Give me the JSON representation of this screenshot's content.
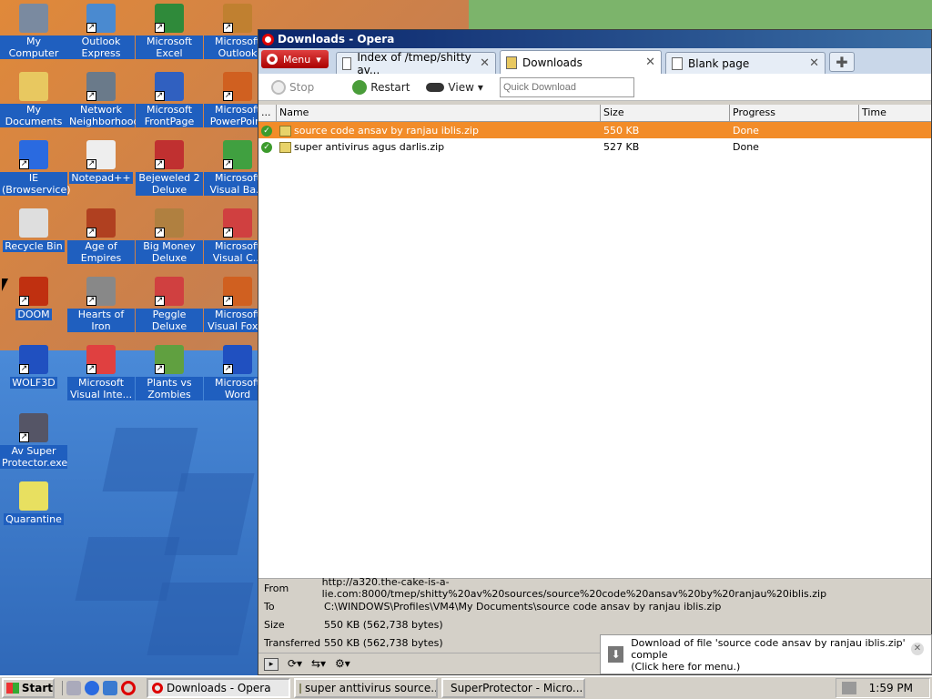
{
  "desktop": {
    "icons": [
      {
        "label": "My Computer",
        "icon": "computer-icon"
      },
      {
        "label": "Outlook Express",
        "icon": "outlook-express-icon"
      },
      {
        "label": "Microsoft Excel",
        "icon": "excel-icon"
      },
      {
        "label": "Microsoft Outlook",
        "icon": "outlook-icon"
      },
      {
        "label": "My Documents",
        "icon": "folder-documents-icon"
      },
      {
        "label": "Network Neighborhood",
        "icon": "network-icon"
      },
      {
        "label": "Microsoft FrontPage",
        "icon": "frontpage-icon"
      },
      {
        "label": "Microsoft PowerPoint",
        "icon": "powerpoint-icon"
      },
      {
        "label": "IE (Browservice)",
        "icon": "ie-icon"
      },
      {
        "label": "Notepad++",
        "icon": "notepad-icon"
      },
      {
        "label": "Bejeweled 2 Deluxe",
        "icon": "bejeweled-icon"
      },
      {
        "label": "Microsoft Visual Ba...",
        "icon": "visual-basic-icon"
      },
      {
        "label": "Recycle Bin",
        "icon": "recycle-bin-icon"
      },
      {
        "label": "Age of Empires",
        "icon": "age-of-empires-icon"
      },
      {
        "label": "Big Money Deluxe",
        "icon": "big-money-icon"
      },
      {
        "label": "Microsoft Visual C...",
        "icon": "visual-c-icon"
      },
      {
        "label": "DOOM",
        "icon": "doom-icon"
      },
      {
        "label": "Hearts of Iron",
        "icon": "hearts-of-iron-icon"
      },
      {
        "label": "Peggle Deluxe",
        "icon": "peggle-icon"
      },
      {
        "label": "Microsoft Visual Fox...",
        "icon": "visual-foxpro-icon"
      },
      {
        "label": "WOLF3D",
        "icon": "wolf3d-icon"
      },
      {
        "label": "Microsoft Visual Inte...",
        "icon": "visual-interdev-icon"
      },
      {
        "label": "Plants vs Zombies",
        "icon": "plants-vs-zombies-icon"
      },
      {
        "label": "Microsoft Word",
        "icon": "word-icon"
      },
      {
        "label": "Av Super Protector.exe",
        "icon": "av-super-protector-icon"
      },
      {
        "label": "Quarantine",
        "icon": "folder-icon"
      }
    ]
  },
  "window": {
    "title": "Downloads - Opera",
    "menu_label": "Menu",
    "tabs": [
      {
        "label": "Index of /tmep/shitty av...",
        "active": false
      },
      {
        "label": "Downloads",
        "active": true
      },
      {
        "label": "Blank page",
        "active": false
      }
    ],
    "toolbar": {
      "stop": "Stop",
      "restart": "Restart",
      "view": "View",
      "quick_download_placeholder": "Quick Download"
    },
    "columns": [
      "...",
      "Name",
      "Size",
      "Progress",
      "Time"
    ],
    "rows": [
      {
        "name": "source code ansav by ranjau iblis.zip",
        "size": "550 KB",
        "progress": "Done",
        "selected": true
      },
      {
        "name": "super antivirus agus darlis.zip",
        "size": "527 KB",
        "progress": "Done",
        "selected": false
      }
    ],
    "details": {
      "from_label": "From",
      "from": "http://a320.the-cake-is-a-lie.com:8000/tmep/shitty%20av%20sources/source%20code%20ansav%20by%20ranjau%20iblis.zip",
      "to_label": "To",
      "to": "C:\\WINDOWS\\Profiles\\VM4\\My Documents\\source code ansav by ranjau iblis.zip",
      "size_label": "Size",
      "size": "550 KB (562,738 bytes)",
      "transferred_label": "Transferred",
      "transferred": "550 KB (562,738 bytes)"
    }
  },
  "notification": {
    "line1": "Download of file 'source code ansav by ranjau iblis.zip' comple",
    "line2": "(Click here for menu.)"
  },
  "taskbar": {
    "start": "Start",
    "tasks": [
      {
        "label": "Downloads - Opera",
        "active": true
      },
      {
        "label": "super anttivirus source....",
        "active": false
      },
      {
        "label": "SuperProtector - Micro...",
        "active": false
      }
    ],
    "clock": "1:59 PM"
  }
}
